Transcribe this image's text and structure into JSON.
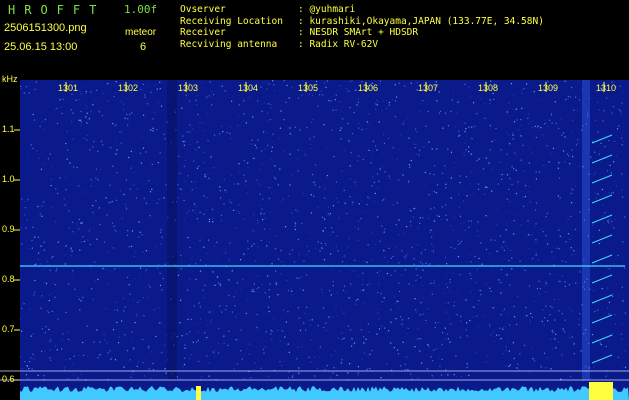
{
  "header": {
    "title": "HROFFT",
    "version": "1.00f",
    "filename": "2506151300.png",
    "datetime": "25.06.15 13:00",
    "meteor_label": "meteor",
    "meteor_count": "6",
    "info": [
      {
        "label": "Ovserver",
        "value": ": @yuhmari"
      },
      {
        "label": "Receiving Location",
        "value": ": kurashiki,Okayama,JAPAN (133.77E, 34.58N)"
      },
      {
        "label": "Receiver",
        "value": ": NESDR SMArt + HDSDR"
      },
      {
        "label": "Recviving antenna",
        "value": ": Radix RV-62V"
      }
    ]
  },
  "spectrogram": {
    "unit_label": "kHz",
    "y_ticks": [
      "1.1",
      "1.0",
      "0.9",
      "0.8",
      "0.7",
      "0.6"
    ],
    "x_ticks": [
      "1301",
      "1302",
      "1303",
      "1304",
      "1305",
      "1306",
      "1307",
      "1308",
      "1309",
      "1310"
    ],
    "colors": {
      "background": "#000000",
      "noise": "#0a1a8a",
      "text": "#ffff40",
      "title": "#7fe040",
      "signal": "#40d8ff"
    }
  }
}
